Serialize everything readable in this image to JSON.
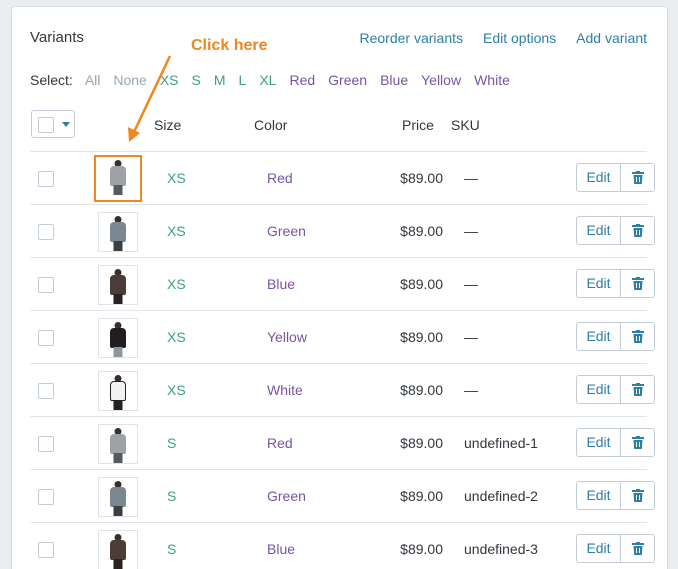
{
  "header": {
    "title": "Variants",
    "links": [
      "Reorder variants",
      "Edit options",
      "Add variant"
    ]
  },
  "select": {
    "label": "Select:",
    "options": [
      {
        "label": "All",
        "color": "#95a7b7"
      },
      {
        "label": "None",
        "color": "#95a7b7"
      },
      {
        "label": "XS",
        "color": "#3aa186"
      },
      {
        "label": "S",
        "color": "#3aa186"
      },
      {
        "label": "M",
        "color": "#3aa186"
      },
      {
        "label": "L",
        "color": "#3aa186"
      },
      {
        "label": "XL",
        "color": "#3aa186"
      },
      {
        "label": "Red",
        "color": "#7a53a6"
      },
      {
        "label": "Green",
        "color": "#7a53a6"
      },
      {
        "label": "Blue",
        "color": "#7a53a6"
      },
      {
        "label": "Yellow",
        "color": "#7a53a6"
      },
      {
        "label": "White",
        "color": "#7a53a6"
      }
    ]
  },
  "columns": {
    "size": "Size",
    "color": "Color",
    "price": "Price",
    "sku": "SKU"
  },
  "annotation": {
    "text": "Click here",
    "color": "#f0861d"
  },
  "edit_label": "Edit",
  "icons": {
    "delete": "trash-icon",
    "caret": "caret-down-icon"
  },
  "rows": [
    {
      "size": "XS",
      "color": "Red",
      "price": "$89.00",
      "sku": "—",
      "thumb": "grey-cardigan",
      "highlight": true
    },
    {
      "size": "XS",
      "color": "Green",
      "price": "$89.00",
      "sku": "—",
      "thumb": "grey-shirt"
    },
    {
      "size": "XS",
      "color": "Blue",
      "price": "$89.00",
      "sku": "—",
      "thumb": "dark-skirt"
    },
    {
      "size": "XS",
      "color": "Yellow",
      "price": "$89.00",
      "sku": "—",
      "thumb": "black-top"
    },
    {
      "size": "XS",
      "color": "White",
      "price": "$89.00",
      "sku": "—",
      "thumb": "white-top"
    },
    {
      "size": "S",
      "color": "Red",
      "price": "$89.00",
      "sku": "undefined-1",
      "thumb": "grey-cardigan"
    },
    {
      "size": "S",
      "color": "Green",
      "price": "$89.00",
      "sku": "undefined-2",
      "thumb": "grey-shirt"
    },
    {
      "size": "S",
      "color": "Blue",
      "price": "$89.00",
      "sku": "undefined-3",
      "thumb": "dark-skirt"
    }
  ]
}
